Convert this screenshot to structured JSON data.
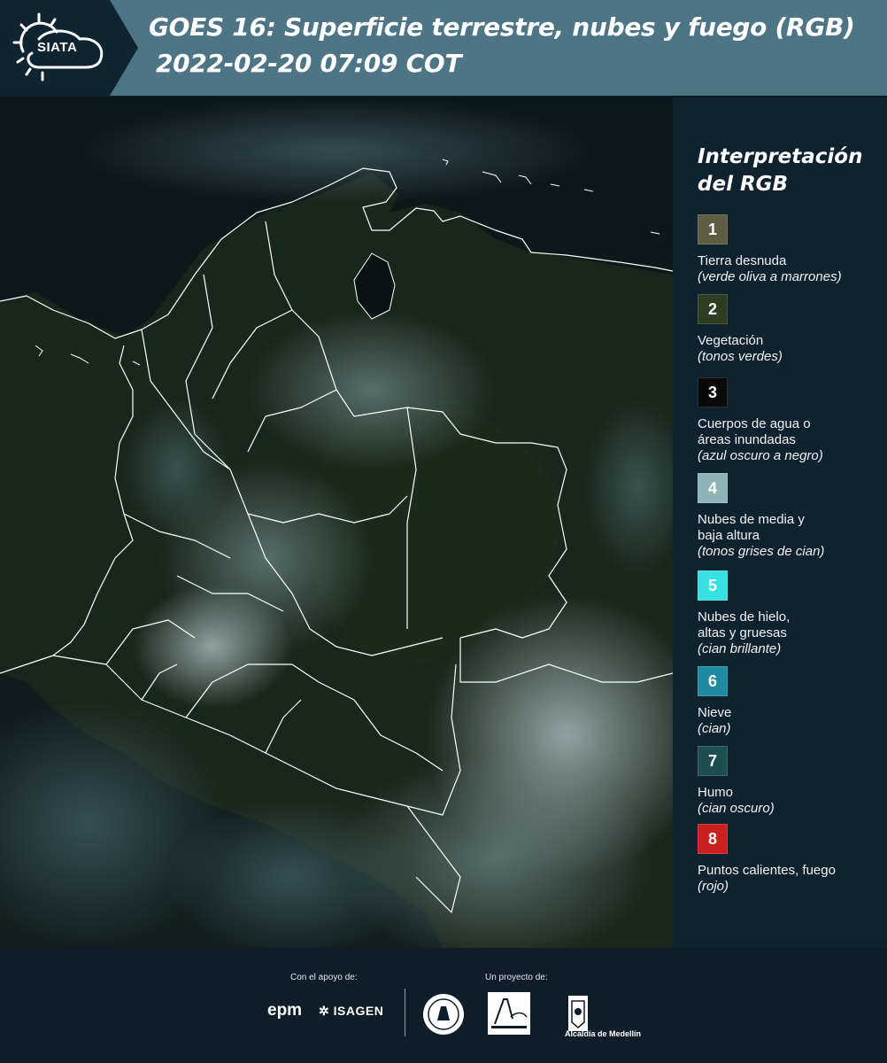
{
  "header": {
    "logo_text": "SIATA",
    "title_line1": "GOES 16: Superficie terrestre, nubes y fuego (RGB)",
    "title_line2": "2022-02-20 07:09 COT"
  },
  "legend": {
    "title_line1": "Interpretación",
    "title_line2": "del RGB",
    "items": [
      {
        "number": "1",
        "label": "Tierra desnuda",
        "desc": "(verde oliva a marrones)",
        "color": "#5f5e44",
        "text_color": "#ffffff"
      },
      {
        "number": "2",
        "label": "Vegetación",
        "desc": "(tonos verdes)",
        "color": "#2f3d23",
        "text_color": "#ffffff"
      },
      {
        "number": "3",
        "label": "Cuerpos de agua o\náreas inundadas",
        "desc": "(azul oscuro a negro)",
        "color": "#0a0a0a",
        "text_color": "#ffffff"
      },
      {
        "number": "4",
        "label": "Nubes de media y\nbaja altura",
        "desc": "(tonos grises de cian)",
        "color": "#8fb4b6",
        "text_color": "#ffffff"
      },
      {
        "number": "5",
        "label": "Nubes de hielo,\naltas y gruesas",
        "desc": "(cian brillante)",
        "color": "#38e0e4",
        "text_color": "#ffffff"
      },
      {
        "number": "6",
        "label": "Nieve",
        "desc": "(cian)",
        "color": "#1f8aa2",
        "text_color": "#ffffff"
      },
      {
        "number": "7",
        "label": "Humo",
        "desc": "(cian oscuro)",
        "color": "#1d4f52",
        "text_color": "#ffffff"
      },
      {
        "number": "8",
        "label": "Puntos calientes, fuego",
        "desc": "(rojo)",
        "color": "#c81f1f",
        "text_color": "#ffffff"
      }
    ]
  },
  "footer": {
    "support_label": "Con el apoyo de:",
    "project_label": "Un proyecto de:",
    "epm": "epm",
    "isagen": "ISAGEN",
    "alcaldia": "Alcaldía de Medellín"
  },
  "colors": {
    "header_bg": "#0f2431",
    "header_band": "#4d7585",
    "legend_bg": "#0f2230"
  }
}
